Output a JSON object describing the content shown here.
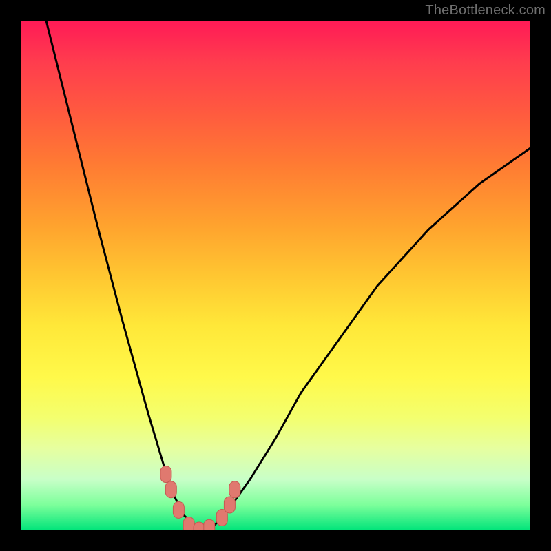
{
  "watermark": "TheBottleneck.com",
  "colors": {
    "frame_bg": "#000000",
    "watermark": "#6f6f6f",
    "curve": "#000000",
    "marker_fill": "#e0796f",
    "marker_stroke": "#c55a52",
    "gradient_stops": [
      "#ff1a56",
      "#ff3c4e",
      "#ff5a3f",
      "#ff7a33",
      "#ffa22e",
      "#ffc631",
      "#ffe839",
      "#fff94a",
      "#f3ff6f",
      "#e6ffa0",
      "#c8ffc8",
      "#7dff9b",
      "#00e47a"
    ]
  },
  "chart_data": {
    "type": "line",
    "title": "",
    "xlabel": "",
    "ylabel": "",
    "xlim": [
      0,
      100
    ],
    "ylim": [
      0,
      100
    ],
    "grid": false,
    "legend": false,
    "note": "Values are estimated from pixel coordinates; axes have no tick labels.",
    "series": [
      {
        "name": "bottleneck-curve",
        "x": [
          5,
          10,
          15,
          20,
          25,
          28,
          30,
          32,
          34,
          36,
          38,
          40,
          45,
          50,
          55,
          60,
          70,
          80,
          90,
          100
        ],
        "values": [
          100,
          80,
          60,
          41,
          23,
          13,
          7,
          3,
          1,
          0,
          1,
          3,
          10,
          18,
          27,
          34,
          48,
          59,
          68,
          75
        ]
      }
    ],
    "markers": {
      "name": "highlighted-points",
      "x": [
        28.5,
        29.5,
        31,
        33,
        35,
        37,
        39.5,
        41,
        42
      ],
      "values": [
        11,
        8,
        4,
        1,
        0,
        0.5,
        2.5,
        5,
        8
      ]
    }
  }
}
